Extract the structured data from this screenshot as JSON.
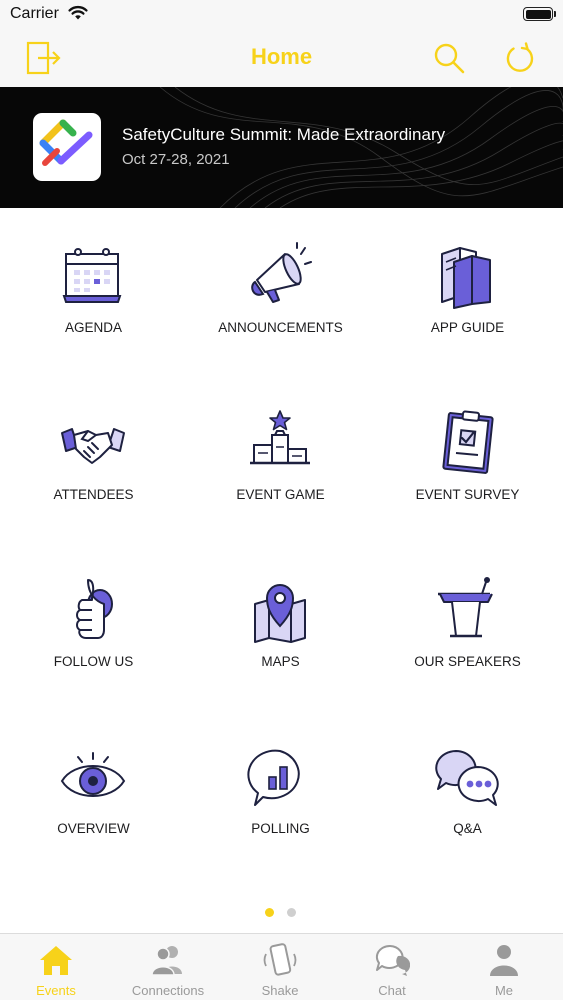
{
  "status_bar": {
    "carrier": "Carrier"
  },
  "nav": {
    "title": "Home"
  },
  "event": {
    "title": "SafetyCulture Summit: Made Extraordinary",
    "dates": "Oct 27-28, 2021"
  },
  "tiles": [
    {
      "label": "AGENDA",
      "icon": "calendar-icon"
    },
    {
      "label": "ANNOUNCEMENTS",
      "icon": "megaphone-icon"
    },
    {
      "label": "APP GUIDE",
      "icon": "book-icon"
    },
    {
      "label": "ATTENDEES",
      "icon": "handshake-icon"
    },
    {
      "label": "EVENT GAME",
      "icon": "podium-star-icon"
    },
    {
      "label": "EVENT SURVEY",
      "icon": "clipboard-icon"
    },
    {
      "label": "FOLLOW US",
      "icon": "thumbs-up-icon"
    },
    {
      "label": "MAPS",
      "icon": "map-pin-icon"
    },
    {
      "label": "OUR SPEAKERS",
      "icon": "lectern-icon"
    },
    {
      "label": "OVERVIEW",
      "icon": "eye-icon"
    },
    {
      "label": "POLLING",
      "icon": "chart-bubble-icon"
    },
    {
      "label": "Q&A",
      "icon": "chat-bubbles-icon"
    }
  ],
  "pager": {
    "current": 1,
    "total": 2
  },
  "tabbar": {
    "items": [
      {
        "label": "Events",
        "icon": "home-icon",
        "active": true
      },
      {
        "label": "Connections",
        "icon": "people-icon",
        "active": false
      },
      {
        "label": "Shake",
        "icon": "phone-shake-icon",
        "active": false
      },
      {
        "label": "Chat",
        "icon": "chat-icon",
        "active": false
      },
      {
        "label": "Me",
        "icon": "person-icon",
        "active": false
      }
    ]
  },
  "colors": {
    "accent": "#f7d21a",
    "icon_purple": "#6a5fd8",
    "icon_stroke": "#1e2140",
    "tab_inactive": "#9a9a9a"
  }
}
